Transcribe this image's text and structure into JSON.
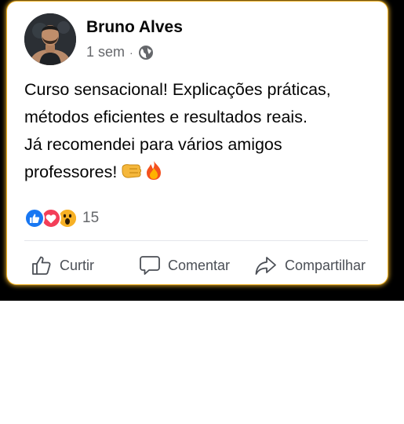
{
  "post": {
    "author": "Bruno Alves",
    "time": "1 sem",
    "separator": "·",
    "privacy_icon": "globe-icon",
    "text_lines": [
      "Curso sensacional! Explicações práticas,",
      "métodos eficientes e resultados reais.",
      "Já recomendei para vários amigos",
      "professores!"
    ],
    "emojis": [
      "punch-emoji",
      "fire-emoji"
    ],
    "reactions": {
      "types": [
        "like",
        "love",
        "wow"
      ],
      "count": "15"
    }
  },
  "actions": {
    "like_label": "Curtir",
    "comment_label": "Comentar",
    "share_label": "Compartilhar"
  },
  "colors": {
    "card_border": "#f0b429",
    "like": "#1877f2",
    "love": "#f33e58",
    "wow": "#f7b125",
    "secondary_text": "#65676b"
  }
}
